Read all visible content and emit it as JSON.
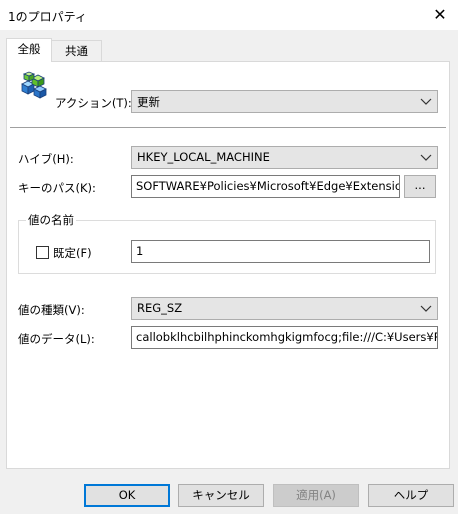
{
  "window": {
    "title": "1のプロパティ",
    "close_glyph": "✕"
  },
  "tabs": [
    {
      "label": "全般",
      "active": true
    },
    {
      "label": "共通",
      "active": false
    }
  ],
  "action": {
    "icon": "registry-cubes-icon",
    "label": "アクション(T):",
    "value": "更新"
  },
  "hive": {
    "label": "ハイブ(H):",
    "value": "HKEY_LOCAL_MACHINE"
  },
  "key_path": {
    "label": "キーのパス(K):",
    "value": "SOFTWARE¥Policies¥Microsoft¥Edge¥ExtensionIn",
    "browse_label": "..."
  },
  "value_name": {
    "group_label": "値の名前",
    "default_label": "既定(F)",
    "default_checked": false,
    "value": "1"
  },
  "value_type": {
    "label": "値の種類(V):",
    "value": "REG_SZ"
  },
  "value_data": {
    "label": "値のデータ(L):",
    "value": "callobklhcbilhphinckomhgkigmfocg;file:///C:¥Users¥Pul"
  },
  "buttons": {
    "ok": "OK",
    "cancel": "キャンセル",
    "apply": "適用(A)",
    "help": "ヘルプ"
  },
  "colors": {
    "accent": "#0078d7",
    "window_bg": "#f0f0f0",
    "panel_bg": "#ffffff"
  }
}
